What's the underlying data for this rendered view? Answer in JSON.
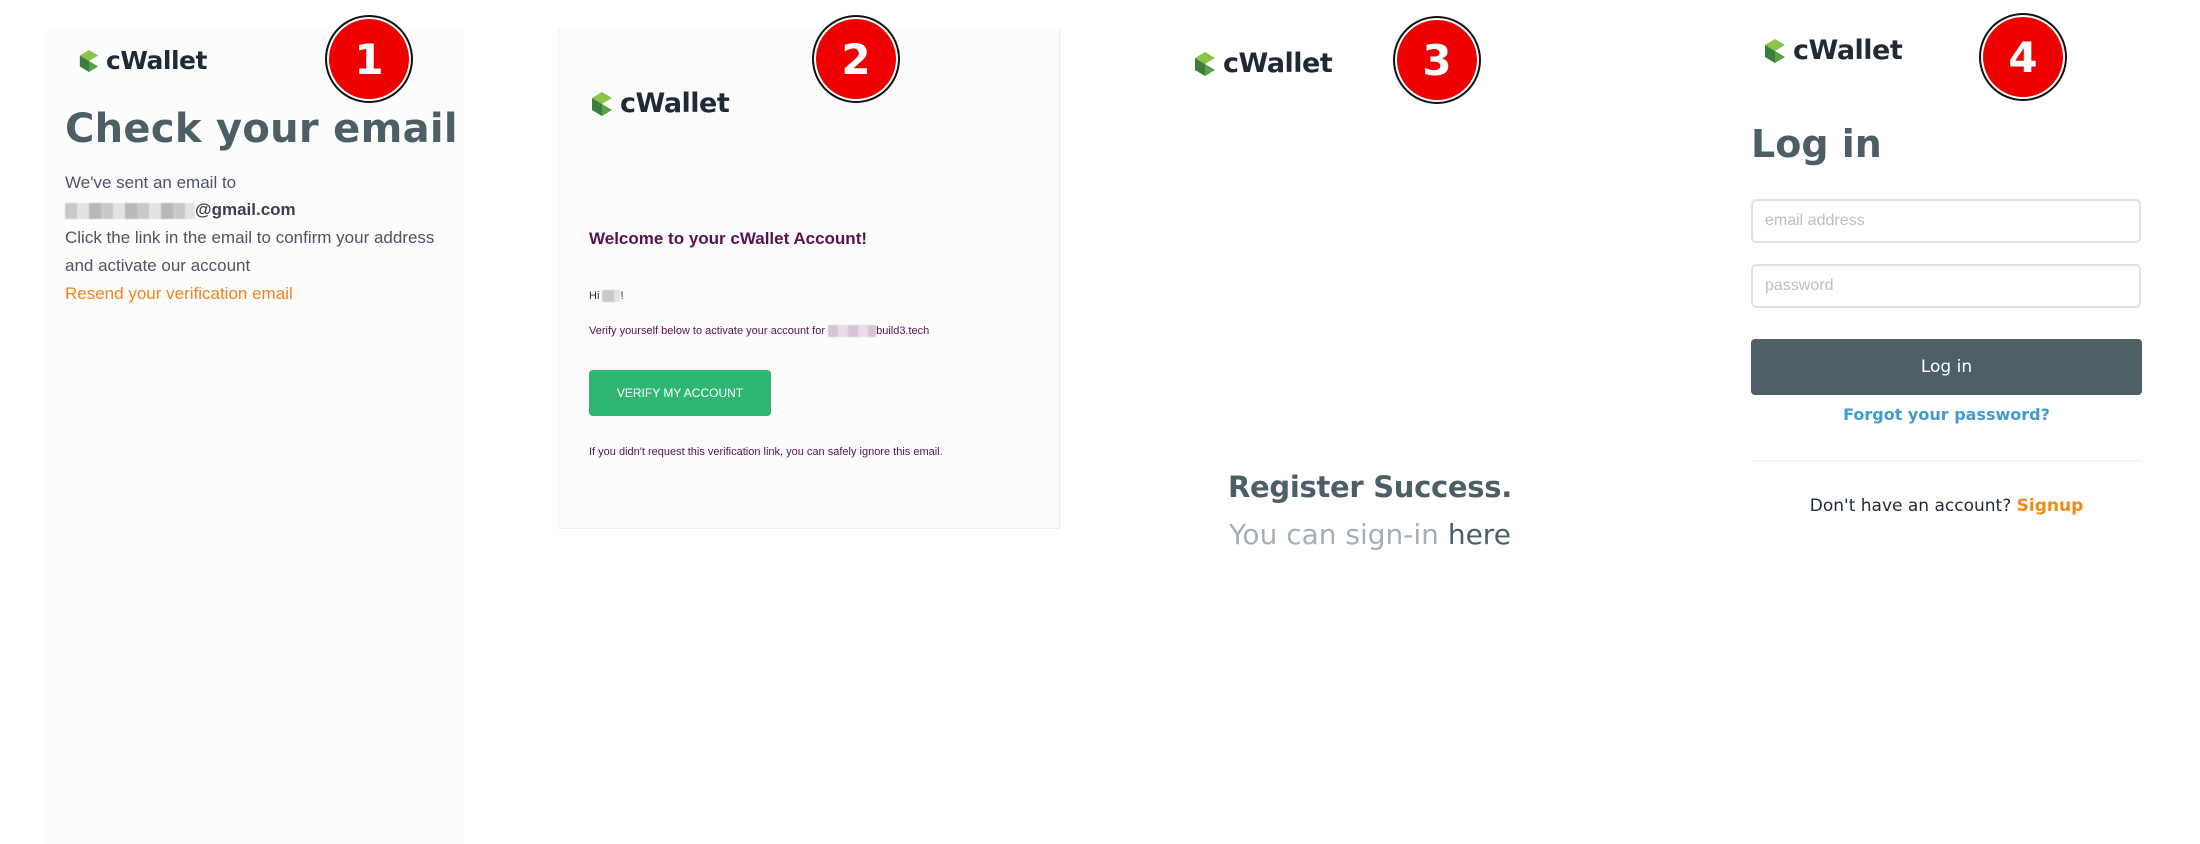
{
  "brand": {
    "name": "cWallet",
    "colors": {
      "logo_dark_green": "#3a7d3c",
      "logo_light_green": "#8cc34b",
      "wordmark": "#1f2a37"
    }
  },
  "steps": [
    "1",
    "2",
    "3",
    "4"
  ],
  "panel1": {
    "title": "Check your email",
    "sent_line": "We've sent an email to",
    "email_domain": "@gmail.com",
    "instruction_1": "Click the link in the email to confirm your address",
    "instruction_2": "and activate our account",
    "resend_link": "Resend your verification email"
  },
  "panel2": {
    "heading": "Welcome to your cWallet Account!",
    "greeting_prefix": "Hi",
    "greeting_suffix": "!",
    "verify_text_prefix": "Verify yourself below to activate your account for",
    "verify_text_domain": "build3.tech",
    "verify_button": "VERIFY MY ACCOUNT",
    "ignore_note": "If you didn't request this verification link, you can safely ignore this email.",
    "colors": {
      "heading": "#5b1150",
      "button": "#2fb672"
    }
  },
  "panel3": {
    "title": "Register Success.",
    "sub_prefix": "You can sign-in ",
    "sub_link": "here"
  },
  "panel4": {
    "title": "Log in",
    "email_placeholder": "email address",
    "password_placeholder": "password",
    "login_button": "Log in",
    "forgot_link": "Forgot your password?",
    "no_account": "Don't have an account?",
    "signup_link": "Signup",
    "colors": {
      "button": "#4f5f66",
      "forgot": "#3f9bd1",
      "signup": "#f08a13"
    }
  }
}
